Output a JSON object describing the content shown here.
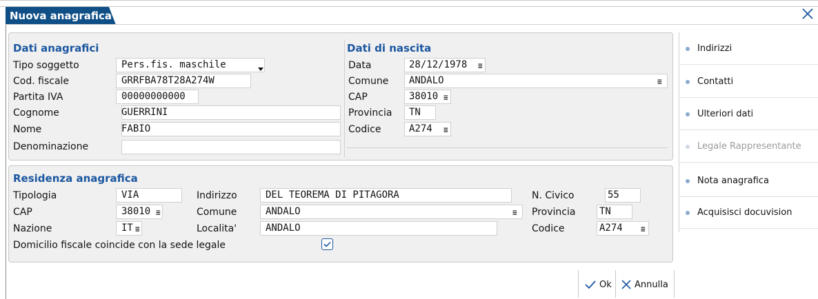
{
  "window": {
    "title": "Nuova anagrafica"
  },
  "anagrafici": {
    "title": "Dati anagrafici",
    "tipo_label": "Tipo soggetto",
    "tipo_value": "Pers.fis. maschile",
    "cf_label": "Cod. fiscale",
    "cf_value": "GRRFBA78T28A274W",
    "piva_label": "Partita IVA",
    "piva_value": "00000000000",
    "cognome_label": "Cognome",
    "cognome_value": "GUERRINI",
    "nome_label": "Nome",
    "nome_value": "FABIO",
    "denom_label": "Denominazione",
    "denom_value": ""
  },
  "nascita": {
    "title": "Dati di nascita",
    "data_label": "Data",
    "data_value": "28/12/1978",
    "comune_label": "Comune",
    "comune_value": "ANDALO",
    "cap_label": "CAP",
    "cap_value": "38010",
    "prov_label": "Provincia",
    "prov_value": "TN",
    "codice_label": "Codice",
    "codice_value": "A274"
  },
  "residenza": {
    "title": "Residenza anagrafica",
    "tipologia_label": "Tipologia",
    "tipologia_value": "VIA",
    "indirizzo_label": "Indirizzo",
    "indirizzo_value": "DEL TEOREMA DI PITAGORA",
    "civico_label": "N. Civico",
    "civico_value": "55",
    "cap_label": "CAP",
    "cap_value": "38010",
    "comune_label": "Comune",
    "comune_value": "ANDALO",
    "prov_label": "Provincia",
    "prov_value": "TN",
    "nazione_label": "Nazione",
    "nazione_value": "IT",
    "localita_label": "Localita'",
    "localita_value": "ANDALO",
    "codice_label": "Codice",
    "codice_value": "A274",
    "domicilio_label": "Domicilio fiscale coincide con la sede legale",
    "domicilio_checked": true
  },
  "sidebar": {
    "items": [
      {
        "label": "Indirizzi",
        "enabled": true
      },
      {
        "label": "Contatti",
        "enabled": true
      },
      {
        "label": "Ulteriori dati",
        "enabled": true
      },
      {
        "label": "Legale Rappresentante",
        "enabled": false
      },
      {
        "label": "Nota anagrafica",
        "enabled": true
      },
      {
        "label": "Acquisisci docuvision",
        "enabled": true
      }
    ]
  },
  "buttons": {
    "ok_label": "Ok",
    "cancel_label": "Annulla"
  },
  "colors": {
    "tab_bg": "#0f4f86",
    "section_title": "#1a56a0",
    "accent_icon": "#1a56a0"
  },
  "icons": {
    "close": "close-icon",
    "dropdown": "chevron-down-icon",
    "lookup": "lookup-icon",
    "check": "check-icon"
  }
}
